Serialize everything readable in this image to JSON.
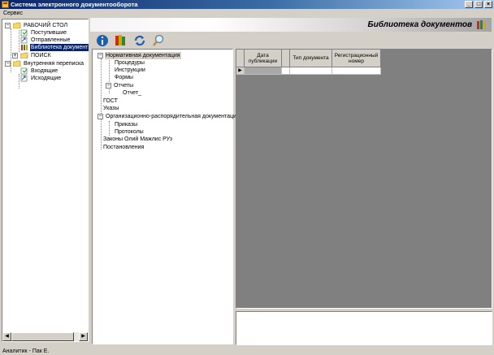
{
  "window": {
    "title": "Система электронного документооборота"
  },
  "window_controls": {
    "minimize": "_",
    "maximize": "□",
    "close": "×"
  },
  "menu": {
    "items": [
      "Сервис"
    ]
  },
  "nav_tree": {
    "items": [
      {
        "label": "РАБОЧИЙ СТОЛ",
        "expander": "−"
      },
      {
        "label": "Поступившие"
      },
      {
        "label": "Отправленные"
      },
      {
        "label": "Библиотека документ"
      },
      {
        "label": "ПОИСК",
        "expander": "+"
      },
      {
        "label": "Внутренняя переписка",
        "expander": "−"
      },
      {
        "label": "Входящие"
      },
      {
        "label": "Исходящие"
      }
    ]
  },
  "header": {
    "title": "Библиотека документов"
  },
  "toolbar": {
    "icons": [
      "info-icon",
      "documents-icon",
      "refresh-icon",
      "search-icon"
    ]
  },
  "doc_tree": {
    "items": [
      {
        "label": "Нормативная документация",
        "expander": "−"
      },
      {
        "label": "Процедуры"
      },
      {
        "label": "Инструкции"
      },
      {
        "label": "Формы"
      },
      {
        "label": "Отчеты",
        "expander": "−"
      },
      {
        "label": "Отчет_"
      },
      {
        "label": "ГОСТ"
      },
      {
        "label": "Указы"
      },
      {
        "label": "Организационно-распорядительная документация",
        "expander": "−"
      },
      {
        "label": "Приказы"
      },
      {
        "label": "Протоколы"
      },
      {
        "label": "Законы Олий Мажлис РУз"
      },
      {
        "label": "Постановления"
      }
    ]
  },
  "grid": {
    "columns": [
      {
        "label": "Дата публикации"
      },
      {
        "label": ""
      },
      {
        "label": "Тип документа"
      },
      {
        "label": "Регистрационный номер"
      }
    ],
    "row_indicator": "▶"
  },
  "scroll_arrows": {
    "left": "◀",
    "right": "▶"
  },
  "status": {
    "text": "Аналитик - Пак Е."
  }
}
